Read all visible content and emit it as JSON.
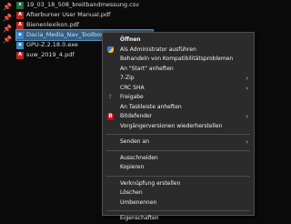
{
  "files": [
    {
      "name": "19_03_18_508_breitbandmessung.csv",
      "type": "csv",
      "icon": "csv-file-icon"
    },
    {
      "name": "Afterburner User Manual.pdf",
      "type": "pdf",
      "icon": "pdf-file-icon"
    },
    {
      "name": "Bienenlexikon.pdf",
      "type": "pdf",
      "icon": "pdf-file-icon"
    },
    {
      "name": "Dacia_Media_Nav_Toolbox_Install.exe",
      "type": "exe",
      "icon": "exe-file-icon"
    },
    {
      "name": "GPU-Z.2.18.0.exe",
      "type": "exe",
      "icon": "exe-file-icon"
    },
    {
      "name": "suw_2019_4.pdf",
      "type": "pdf",
      "icon": "pdf-file-icon"
    }
  ],
  "selected_file_index": 3,
  "menu": {
    "open": "Öffnen",
    "run_as_admin": "Als Administrator ausführen",
    "troubleshoot": "Behandeln von Kompatibilitätsproblemen",
    "pin_start": "An \"Start\" anheften",
    "seven_zip": "7-Zip",
    "crc_sha": "CRC SHA",
    "share": "Freigabe",
    "pin_taskbar": "An Taskleiste anheften",
    "bitdefender": "Bitdefender",
    "restore_versions": "Vorgängerversionen wiederherstellen",
    "send_to": "Senden an",
    "cut": "Ausschneiden",
    "copy": "Kopieren",
    "create_shortcut": "Verknüpfung erstellen",
    "delete": "Löschen",
    "rename": "Umbenennen",
    "properties": "Eigenschaften"
  },
  "colors": {
    "menu_bg": "#2b2b2b",
    "selection": "#355f84",
    "pdf_red": "#b7261c",
    "bitdefender_red": "#d0021b"
  }
}
